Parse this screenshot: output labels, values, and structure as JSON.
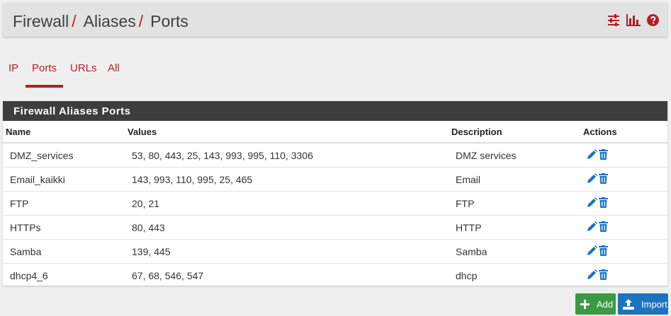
{
  "breadcrumb": {
    "part1": "Firewall",
    "part2": "Aliases",
    "part3": "Ports",
    "separator": "/"
  },
  "header_icons": [
    "settings-sliders-icon",
    "bar-chart-icon",
    "help-icon"
  ],
  "tabs": [
    {
      "label": "IP",
      "active": false
    },
    {
      "label": "Ports",
      "active": true
    },
    {
      "label": "URLs",
      "active": false
    },
    {
      "label": "All",
      "active": false
    }
  ],
  "panel": {
    "title": "Firewall Aliases Ports"
  },
  "table": {
    "headers": {
      "name": "Name",
      "values": "Values",
      "description": "Description",
      "actions": "Actions"
    },
    "rows": [
      {
        "name": "DMZ_services",
        "values": "53, 80, 443, 25, 143, 993, 995, 110, 3306",
        "description": "DMZ services"
      },
      {
        "name": "Email_kaikki",
        "values": "143, 993, 110, 995, 25, 465",
        "description": "Email"
      },
      {
        "name": "FTP",
        "values": "20, 21",
        "description": "FTP"
      },
      {
        "name": "HTTPs",
        "values": "80, 443",
        "description": "HTTP"
      },
      {
        "name": "Samba",
        "values": "139, 445",
        "description": "Samba"
      },
      {
        "name": "dhcp4_6",
        "values": "67, 68, 546, 547",
        "description": "dhcp"
      }
    ]
  },
  "buttons": {
    "add": "Add",
    "import": "Import"
  },
  "colors": {
    "accent": "#b41f24",
    "panel_heading": "#3d3d3d",
    "action_blue": "#1e73be",
    "add_green": "#3c9a46"
  }
}
